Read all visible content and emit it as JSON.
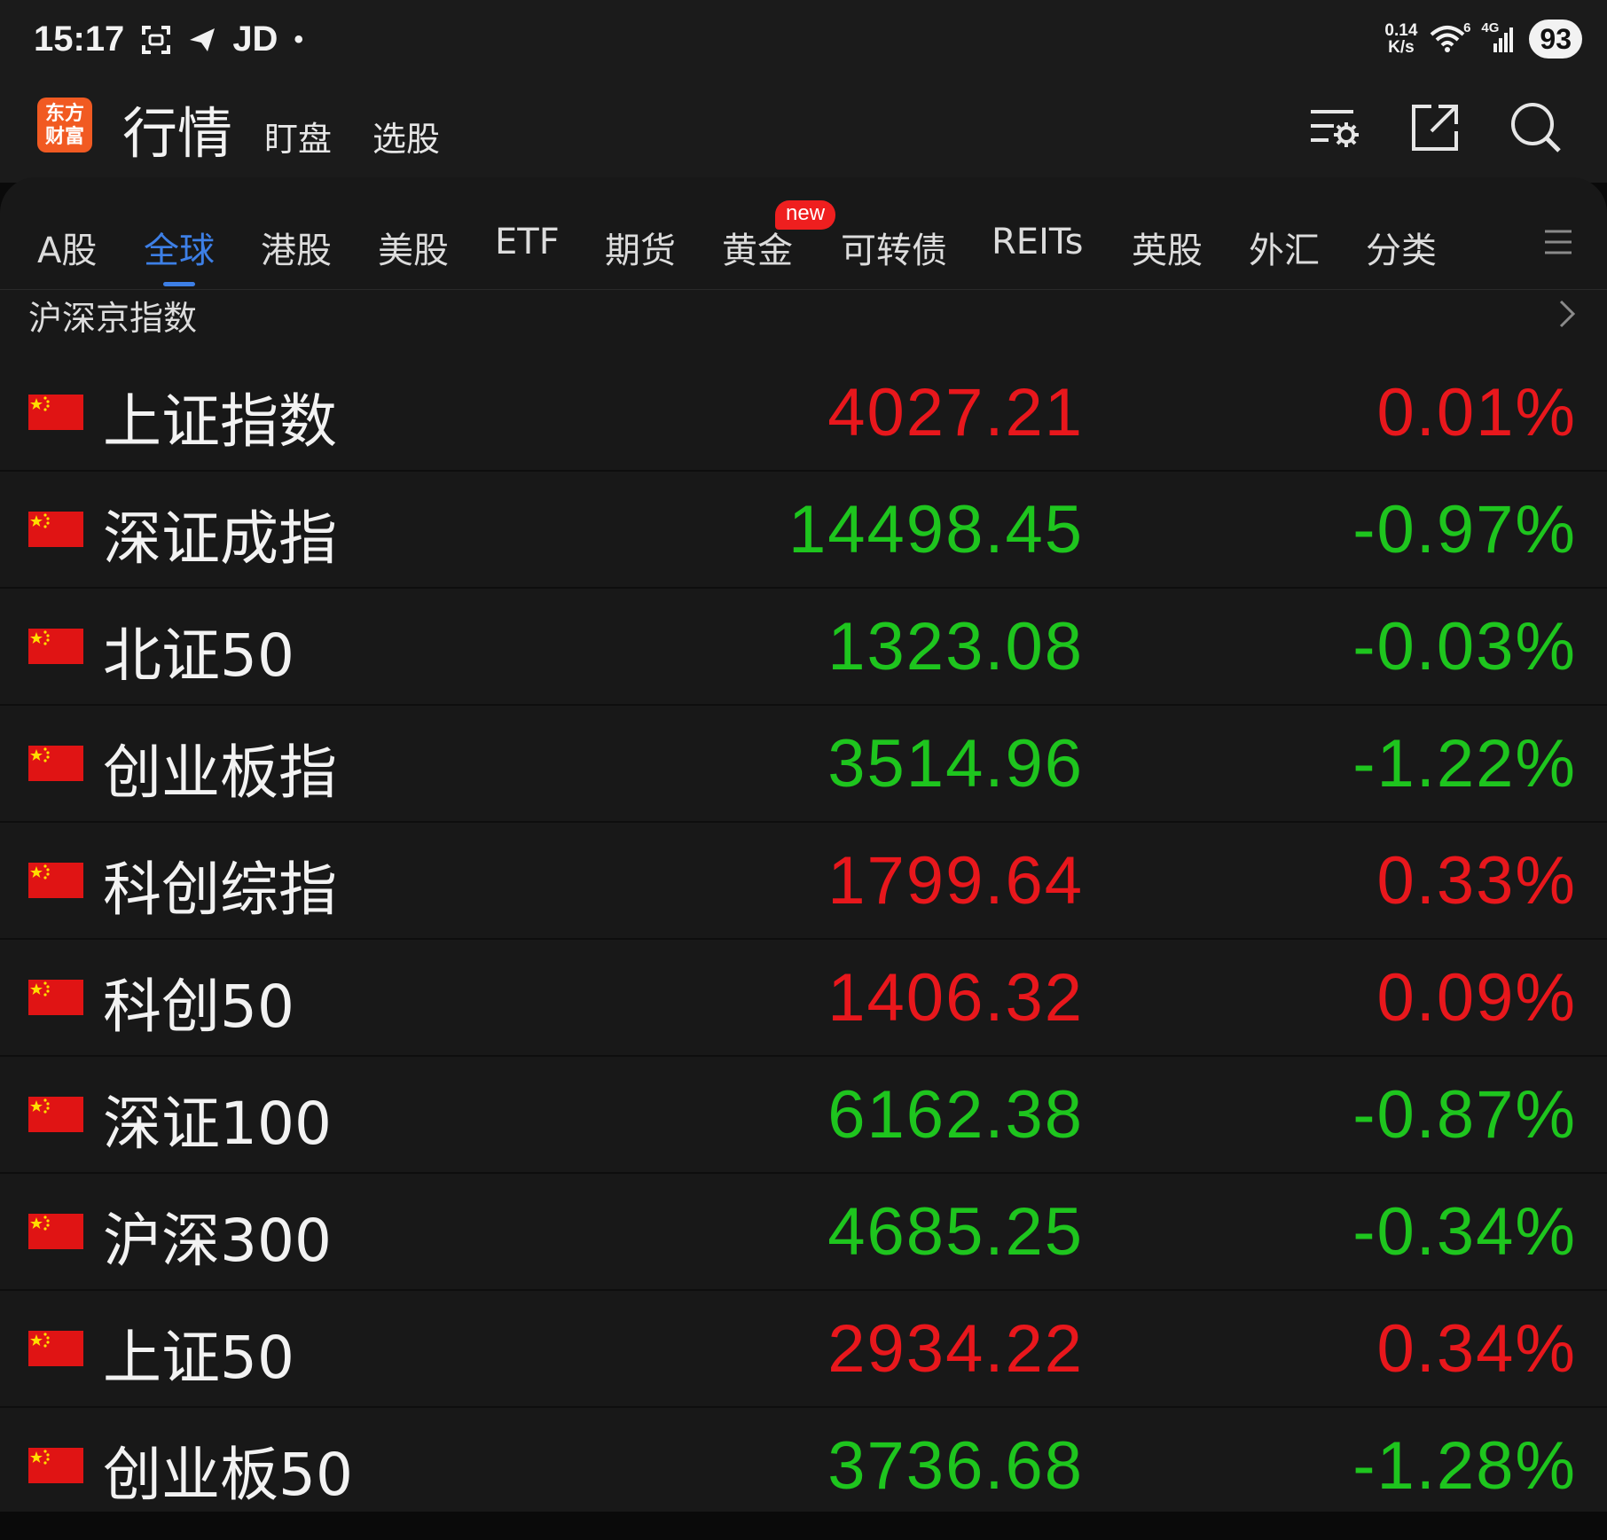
{
  "status_bar": {
    "time": "15:17",
    "carrier": "JD",
    "dot": "•",
    "net_speed_value": "0.14",
    "net_speed_unit": "K/s",
    "wifi_label": "6",
    "cell_label": "4G",
    "battery": "93"
  },
  "header": {
    "logo_line1": "东方",
    "logo_line2": "财富",
    "title": "行情",
    "tabs": [
      "盯盘",
      "选股"
    ],
    "icons": [
      "list-settings-icon",
      "share-icon",
      "search-icon"
    ]
  },
  "tabs": {
    "items": [
      "A股",
      "全球",
      "港股",
      "美股",
      "ETF",
      "期货",
      "黄金",
      "可转债",
      "REITs",
      "英股",
      "外汇",
      "分类"
    ],
    "active_index": 1,
    "new_badge": "new",
    "badge_on_index": 6
  },
  "section": {
    "title": "沪深京指数"
  },
  "colors": {
    "up": "#e8171c",
    "down": "#1ec51e",
    "accent": "#3d7fe6",
    "brand": "#f15a22"
  },
  "indices": [
    {
      "name": "上证指数",
      "value": "4027.21",
      "change": "0.01%",
      "dir": "up"
    },
    {
      "name": "深证成指",
      "value": "14498.45",
      "change": "-0.97%",
      "dir": "down"
    },
    {
      "name": "北证50",
      "value": "1323.08",
      "change": "-0.03%",
      "dir": "down"
    },
    {
      "name": "创业板指",
      "value": "3514.96",
      "change": "-1.22%",
      "dir": "down"
    },
    {
      "name": "科创综指",
      "value": "1799.64",
      "change": "0.33%",
      "dir": "up"
    },
    {
      "name": "科创50",
      "value": "1406.32",
      "change": "0.09%",
      "dir": "up"
    },
    {
      "name": "深证100",
      "value": "6162.38",
      "change": "-0.87%",
      "dir": "down"
    },
    {
      "name": "沪深300",
      "value": "4685.25",
      "change": "-0.34%",
      "dir": "down"
    },
    {
      "name": "上证50",
      "value": "2934.22",
      "change": "0.34%",
      "dir": "up"
    },
    {
      "name": "创业板50",
      "value": "3736.68",
      "change": "-1.28%",
      "dir": "down"
    }
  ]
}
